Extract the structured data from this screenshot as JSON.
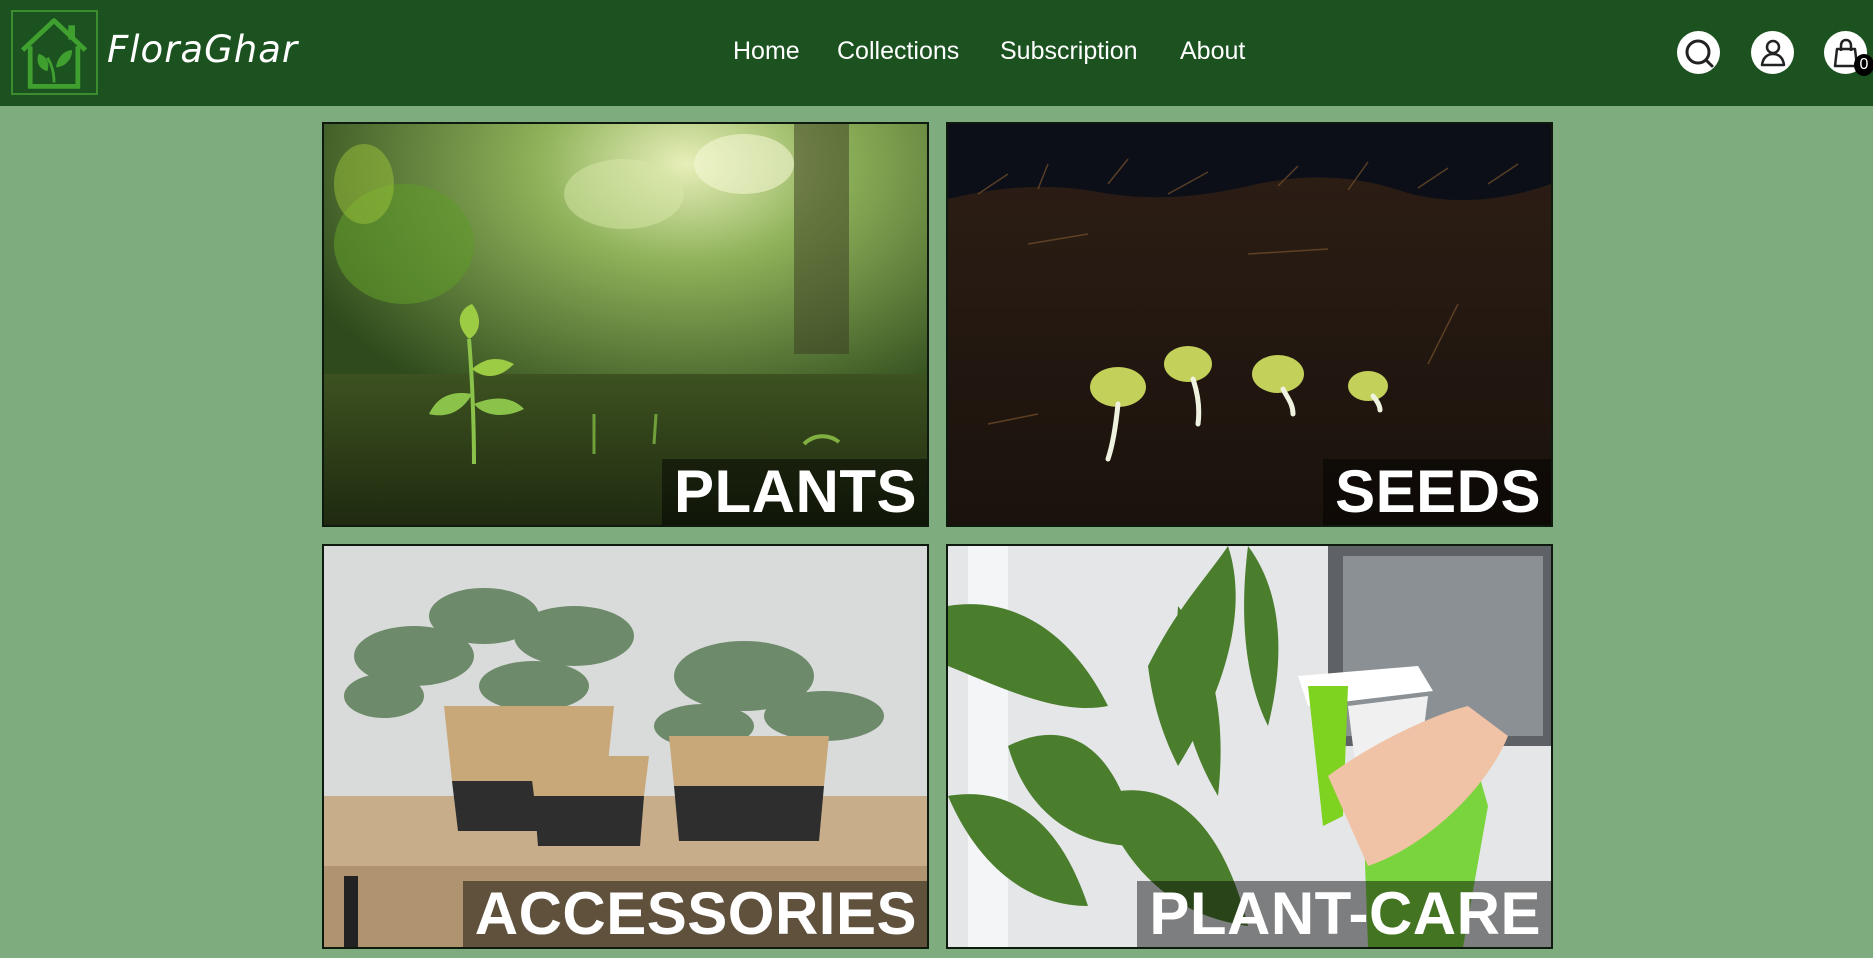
{
  "brand": {
    "name": "FloraGhar"
  },
  "nav": {
    "items": [
      "Home",
      "Collections",
      "Subscription",
      "About"
    ]
  },
  "header_icons": {
    "search": "search-icon",
    "account": "user-icon",
    "cart": "shopping-bag-icon",
    "cart_count": "0"
  },
  "categories": [
    "PLANTS",
    "SEEDS",
    "ACCESSORIES",
    "PLANT-CARE"
  ],
  "colors": {
    "header_bg": "#1b5220",
    "page_bg": "#7eac7e",
    "logo_accent": "#3c8d2f"
  }
}
